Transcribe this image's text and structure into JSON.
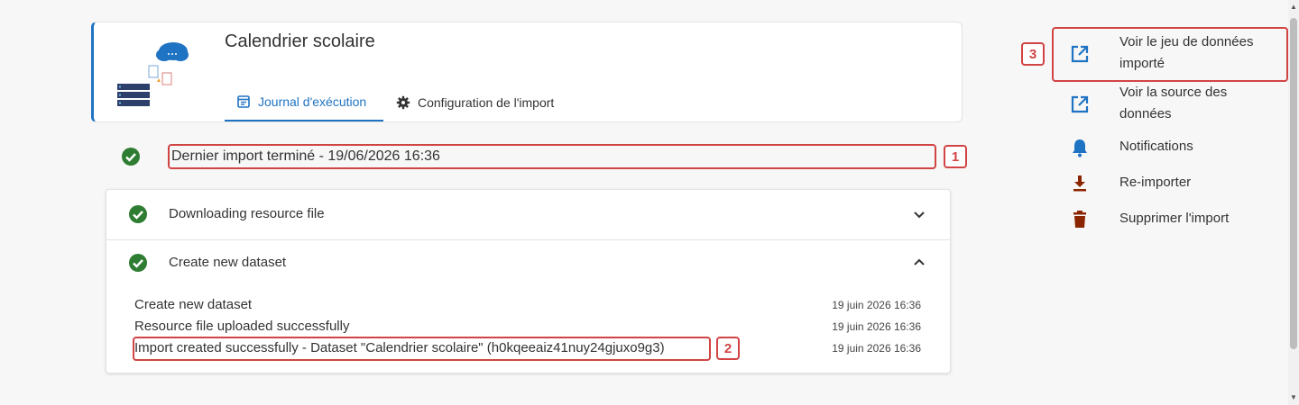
{
  "header": {
    "title": "Calendrier scolaire",
    "tabs": [
      {
        "label": "Journal d'exécution",
        "icon": "journal-icon",
        "active": true
      },
      {
        "label": "Configuration de l'import",
        "icon": "gear-icon",
        "active": false
      }
    ]
  },
  "status": {
    "last_import": "Dernier import terminé - 19/06/2026 16:36",
    "marker": "1",
    "color": "#2e7d32"
  },
  "steps": [
    {
      "label": "Downloading resource file",
      "expanded": false
    },
    {
      "label": "Create new dataset",
      "expanded": true
    }
  ],
  "logs": [
    {
      "message": "Create new dataset",
      "time": "19 juin 2026 16:36"
    },
    {
      "message": "Resource file uploaded successfully",
      "time": "19 juin 2026 16:36"
    },
    {
      "message": "Import created successfully - Dataset \"Calendrier scolaire\" (h0kqeeaiz41nuy24gjuxo9g3)",
      "time": "19 juin 2026 16:36"
    }
  ],
  "log_marker": "2",
  "sidebar": {
    "marker": "3",
    "items": [
      {
        "label_line1": "Voir le jeu de données",
        "label_line2": "importé",
        "icon": "external-link-icon"
      },
      {
        "label_line1": "Voir la source des",
        "label_line2": "données",
        "icon": "external-link-icon"
      },
      {
        "label": "Notifications",
        "icon": "bell-icon"
      },
      {
        "label": "Re-importer",
        "icon": "download-icon"
      },
      {
        "label": "Supprimer l'import",
        "icon": "trash-icon"
      }
    ]
  },
  "colors": {
    "accent": "#1f73c3",
    "highlight": "#d14444",
    "success": "#2e7d32",
    "danger": "#8b2500"
  }
}
